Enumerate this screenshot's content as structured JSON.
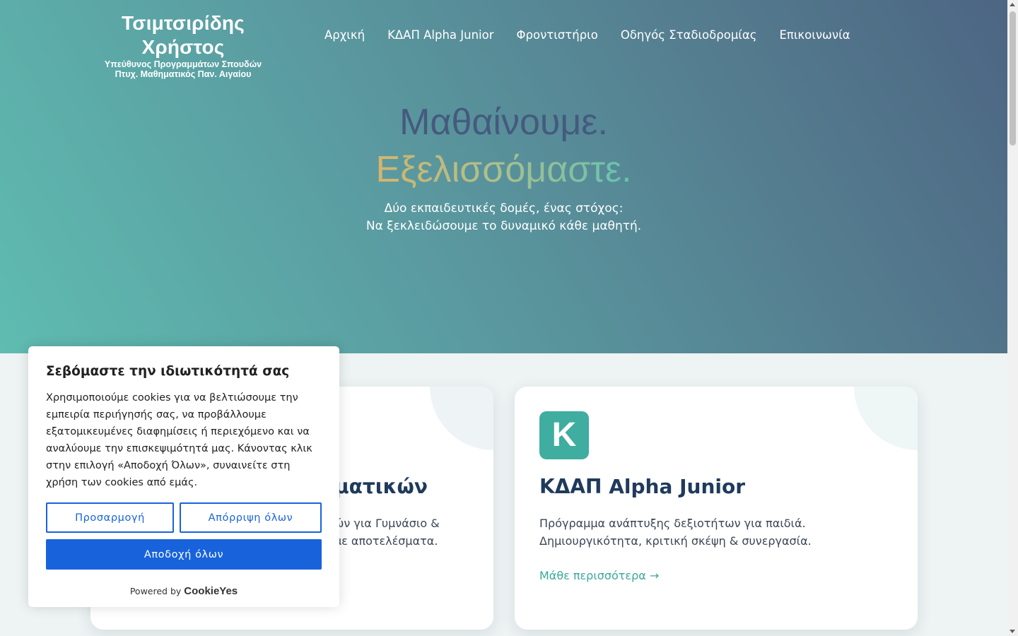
{
  "logo": {
    "title": "Τσιμτσιρίδης Χρήστος",
    "subtitle1": "Υπεύθυνος Προγραμμάτων Σπουδών",
    "subtitle2": "Πτυχ. Μαθηματικός Παν. Αιγαίου"
  },
  "nav": {
    "items": [
      {
        "label": "Αρχική"
      },
      {
        "label": "ΚΔΑΠ Alpha Junior"
      },
      {
        "label": "Φροντιστήριο"
      },
      {
        "label": "Οδηγός Σταδιοδρομίας"
      },
      {
        "label": "Επικοινωνία"
      }
    ]
  },
  "hero": {
    "title1": "Μαθαίνουμε.",
    "title2": "Εξελισσόμαστε.",
    "sub1": "Δύο εκπαιδευτικές δομές, ένας στόχος:",
    "sub2": "Να ξεκλειδώσουμε το δυναμικό κάθε μαθητή."
  },
  "cards": {
    "left": {
      "title_partial": "ματικών",
      "text1_partial": "ών για Γυμνάσιο &",
      "text2_partial": "με αποτελέσματα."
    },
    "right": {
      "badge": "K",
      "title": "ΚΔΑΠ Alpha Junior",
      "text1": "Πρόγραμμα ανάπτυξης δεξιοτήτων για παιδιά.",
      "text2": "Δημιουργικότητα, κριτική σκέψη & συνεργασία.",
      "link": "Μάθε περισσότερα →"
    }
  },
  "cookie": {
    "title": "Σεβόμαστε την ιδιωτικότητά σας",
    "text": "Χρησιμοποιούμε cookies για να βελτιώσουμε την εμπειρία περιήγησής σας, να προβάλλουμε εξατομικευμένες διαφημίσεις ή περιεχόμενο και να αναλύουμε την επισκεψιμότητά μας. Κάνοντας κλικ στην επιλογή «Αποδοχή Όλων», συναινείτε στη χρήση των cookies από εμάς.",
    "customize": "Προσαρμογή",
    "reject": "Απόρριψη όλων",
    "accept": "Αποδοχή όλων",
    "powered_by": "Powered by",
    "brand": "CookieYes"
  },
  "colors": {
    "accent": "#3fada0",
    "cookie_blue": "#1863dc",
    "heading": "#1f3a5c"
  }
}
